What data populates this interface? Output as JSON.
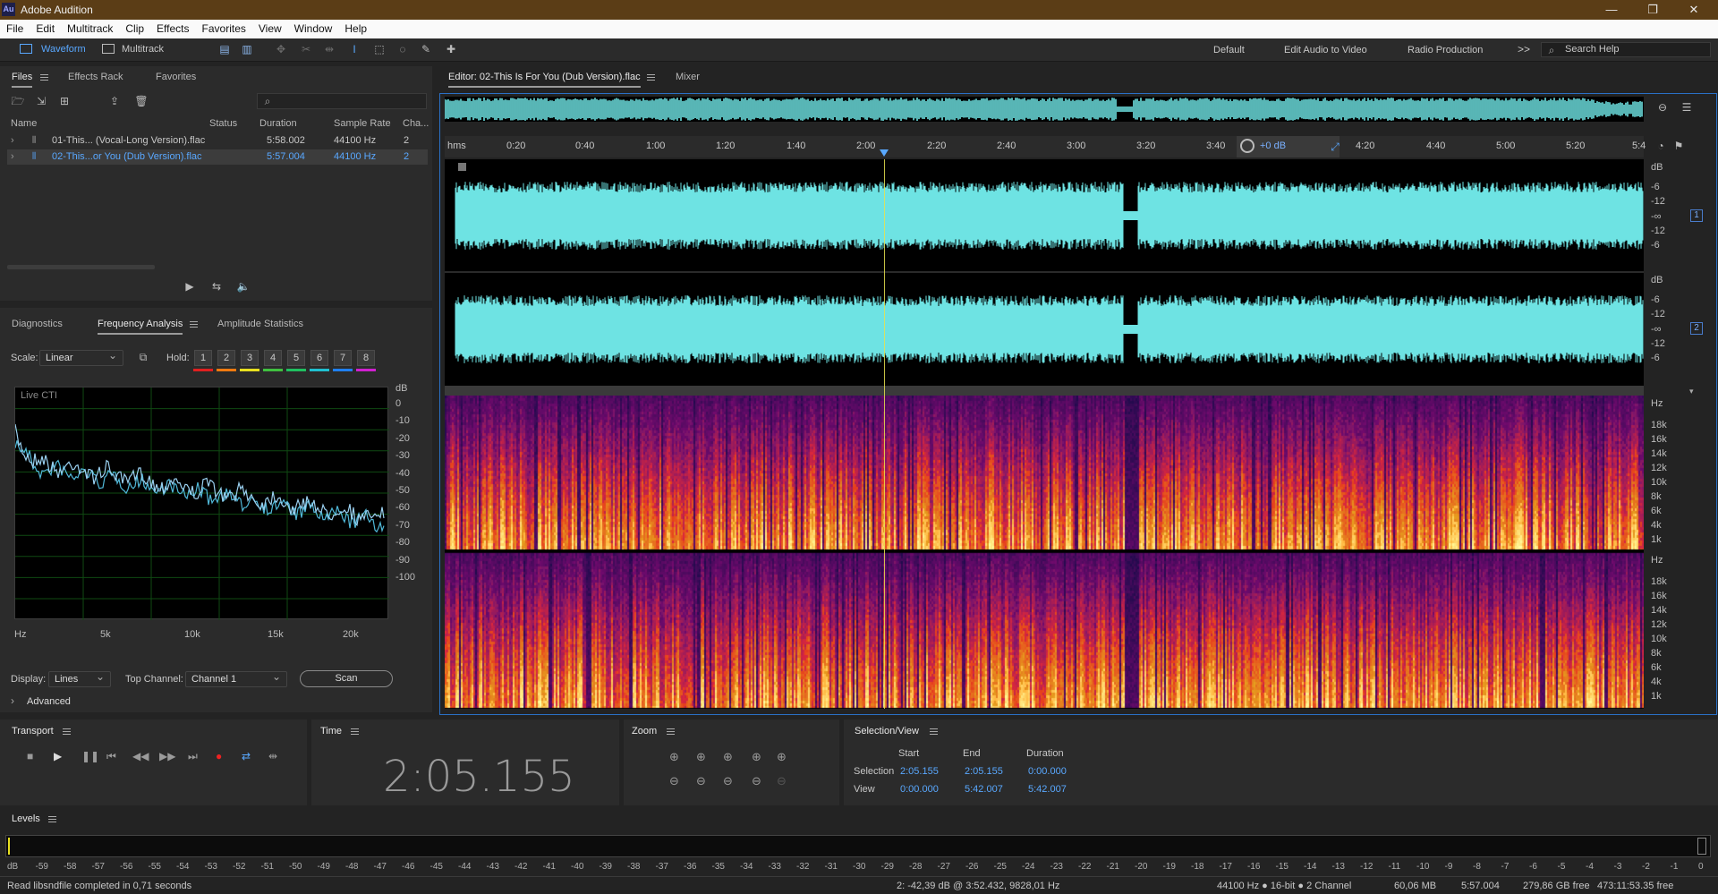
{
  "app": {
    "title": "Adobe Audition",
    "icon_label": "Au"
  },
  "menubar": [
    "File",
    "Edit",
    "Multitrack",
    "Clip",
    "Effects",
    "Favorites",
    "View",
    "Window",
    "Help"
  ],
  "toolbar": {
    "waveform_label": "Waveform",
    "multitrack_label": "Multitrack",
    "workspaces": [
      "Default",
      "Edit Audio to Video",
      "Radio Production"
    ],
    "more": ">>",
    "search_placeholder": "Search Help"
  },
  "files_panel": {
    "tabs": [
      "Files",
      "Effects Rack",
      "Favorites"
    ],
    "columns": [
      "Name",
      "Status",
      "Duration",
      "Sample Rate",
      "Cha..."
    ],
    "rows": [
      {
        "name": "01-This... (Vocal-Long Version).flac",
        "status": "",
        "duration": "5:58.002",
        "sample_rate": "44100 Hz",
        "channels": "2"
      },
      {
        "name": "02-This...or You (Dub Version).flac",
        "status": "",
        "duration": "5:57.004",
        "sample_rate": "44100 Hz",
        "channels": "2"
      }
    ]
  },
  "analysis_panel": {
    "tabs": [
      "Diagnostics",
      "Frequency Analysis",
      "Amplitude Statistics"
    ],
    "scale_label": "Scale:",
    "scale_value": "Linear",
    "hold_label": "Hold:",
    "hold_buttons": [
      "1",
      "2",
      "3",
      "4",
      "5",
      "6",
      "7",
      "8"
    ],
    "hold_colors": [
      "#e02020",
      "#f07a10",
      "#e8e020",
      "#40c040",
      "#20c060",
      "#20c0d0",
      "#2080f0",
      "#d020d0"
    ],
    "graph_label": "Live CTI",
    "db_unit": "dB",
    "db_ticks": [
      "0",
      "-10",
      "-20",
      "-30",
      "-40",
      "-50",
      "-60",
      "-70",
      "-80",
      "-90",
      "-100"
    ],
    "hz_ticks": [
      "Hz",
      "5k",
      "10k",
      "15k",
      "20k"
    ],
    "display_label": "Display:",
    "display_value": "Lines",
    "top_channel_label": "Top Channel:",
    "top_channel_value": "Channel 1",
    "scan_label": "Scan",
    "advanced_label": "Advanced"
  },
  "editor": {
    "tab_label": "Editor: 02-This Is For You (Dub Version).flac",
    "mixer_label": "Mixer",
    "time_unit": "hms",
    "timeline": [
      "0:20",
      "0:40",
      "1:00",
      "1:20",
      "1:40",
      "2:00",
      "2:20",
      "2:40",
      "3:00",
      "3:20",
      "3:40",
      "4:20",
      "4:40",
      "5:00",
      "5:20",
      "5:4"
    ],
    "gain_label": "+0 dB",
    "wave_db_ticks": [
      "dB",
      "-6",
      "-12",
      "-∞",
      "-12",
      "-6"
    ],
    "channels": [
      "1",
      "2"
    ],
    "hz_unit": "Hz",
    "spec_ticks": [
      "18k",
      "16k",
      "14k",
      "12k",
      "10k",
      "8k",
      "6k",
      "4k",
      "1k"
    ],
    "wave_color": "#6ee3e3",
    "playhead_color": "#e8e050"
  },
  "transport": {
    "title": "Transport"
  },
  "time_panel": {
    "title": "Time",
    "value": "2:05.155"
  },
  "zoom_panel": {
    "title": "Zoom"
  },
  "selection_view": {
    "title": "Selection/View",
    "columns": [
      "Start",
      "End",
      "Duration"
    ],
    "selection_label": "Selection",
    "selection": [
      "2:05.155",
      "2:05.155",
      "0:00.000"
    ],
    "view_label": "View",
    "view": [
      "0:00.000",
      "5:42.007",
      "5:42.007"
    ]
  },
  "levels": {
    "title": "Levels",
    "scale": [
      "dB",
      "-59",
      "-58",
      "-57",
      "-56",
      "-55",
      "-54",
      "-53",
      "-52",
      "-51",
      "-50",
      "-49",
      "-48",
      "-47",
      "-46",
      "-45",
      "-44",
      "-43",
      "-42",
      "-41",
      "-40",
      "-39",
      "-38",
      "-37",
      "-36",
      "-35",
      "-34",
      "-33",
      "-32",
      "-31",
      "-30",
      "-29",
      "-28",
      "-27",
      "-26",
      "-25",
      "-24",
      "-23",
      "-22",
      "-21",
      "-20",
      "-19",
      "-18",
      "-17",
      "-16",
      "-15",
      "-14",
      "-13",
      "-12",
      "-11",
      "-10",
      "-9",
      "-8",
      "-7",
      "-6",
      "-5",
      "-4",
      "-3",
      "-2",
      "-1",
      "0"
    ]
  },
  "status": {
    "message": "Read libsndfile completed in 0,71 seconds",
    "cursor": "2: -42,39 dB @ 3:52.432, 9828,01 Hz",
    "format": "44100 Hz ● 16-bit ● 2 Channel",
    "size": "60,06 MB",
    "duration": "5:57.004",
    "free": "279,86 GB free",
    "time_free": "473:11:53.35 free"
  }
}
